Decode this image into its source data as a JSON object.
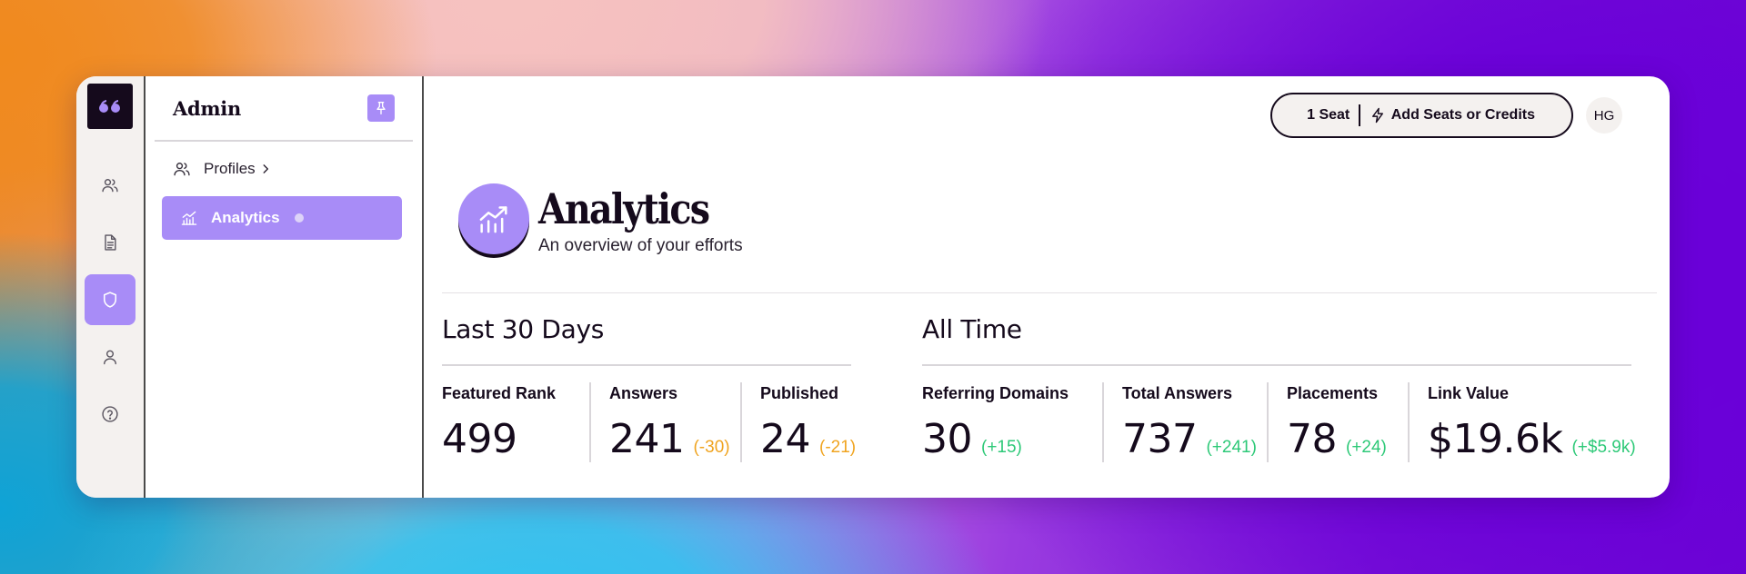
{
  "colors": {
    "accent": "#a88cf7",
    "ink": "#150a1c",
    "negative": "#f0a420",
    "positive": "#2ec978"
  },
  "rail": {
    "logo": "quote-logo-icon",
    "items": [
      {
        "icon": "users-icon",
        "active": false
      },
      {
        "icon": "document-icon",
        "active": false
      },
      {
        "icon": "shield-icon",
        "active": true
      },
      {
        "icon": "user-icon",
        "active": false
      },
      {
        "icon": "help-circle-icon",
        "active": false
      }
    ]
  },
  "sidebar": {
    "title": "Admin",
    "pin_icon": "pin-icon",
    "items": [
      {
        "label": "Profiles",
        "icon": "users-icon",
        "suffix_icon": "chevron-right-icon"
      },
      {
        "label": "Analytics",
        "icon": "chart-icon",
        "active": true
      }
    ]
  },
  "topbar": {
    "seats": "1 Seat",
    "add_label": "Add Seats or Credits",
    "avatar_initials": "HG"
  },
  "page": {
    "title": "Analytics",
    "subtitle": "An overview of your efforts"
  },
  "last30": {
    "title": "Last 30 Days",
    "stats": [
      {
        "label": "Featured Rank",
        "value": "499",
        "delta": ""
      },
      {
        "label": "Answers",
        "value": "241",
        "delta": "(-30)"
      },
      {
        "label": "Published",
        "value": "24",
        "delta": "(-21)"
      }
    ]
  },
  "alltime": {
    "title": "All Time",
    "stats": [
      {
        "label": "Referring Domains",
        "value": "30",
        "delta": "(+15)"
      },
      {
        "label": "Total Answers",
        "value": "737",
        "delta": "(+241)"
      },
      {
        "label": "Placements",
        "value": "78",
        "delta": "(+24)"
      },
      {
        "label": "Link Value",
        "value": "$19.6k",
        "delta": "(+$5.9k)"
      }
    ]
  }
}
